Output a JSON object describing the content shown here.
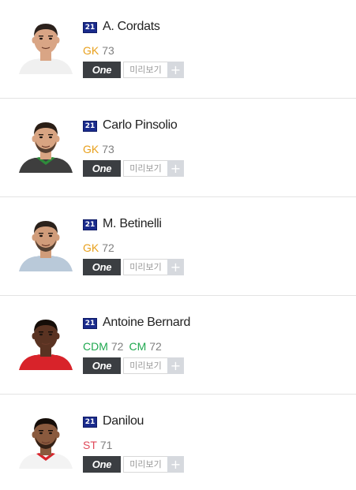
{
  "player_list": {
    "players": [
      {
        "season": "21",
        "name": "A. Cordats",
        "positions": [
          {
            "code": "GK",
            "ovr": "73",
            "color": "#e8a01d"
          }
        ],
        "one_label": "One",
        "preview_label": "미리보기",
        "add_label": "+",
        "kit_color": "#f0f0f0",
        "collar_color": "#f0f0f0",
        "skin_color": "#d9a585",
        "hair_color": "#2b211c",
        "beard": false
      },
      {
        "season": "21",
        "name": "Carlo Pinsolio",
        "positions": [
          {
            "code": "GK",
            "ovr": "73",
            "color": "#e8a01d"
          }
        ],
        "one_label": "One",
        "preview_label": "미리보기",
        "add_label": "+",
        "kit_color": "#3e3e3e",
        "collar_color": "#2e8b3a",
        "skin_color": "#d8a482",
        "hair_color": "#2a1e16",
        "beard": true
      },
      {
        "season": "21",
        "name": "M. Betinelli",
        "positions": [
          {
            "code": "GK",
            "ovr": "72",
            "color": "#e8a01d"
          }
        ],
        "one_label": "One",
        "preview_label": "미리보기",
        "add_label": "+",
        "kit_color": "#b9c9d9",
        "collar_color": "#b9c9d9",
        "skin_color": "#d09c7a",
        "hair_color": "#2a211b",
        "beard": true
      },
      {
        "season": "21",
        "name": "Antoine Bernard",
        "positions": [
          {
            "code": "CDM",
            "ovr": "72",
            "color": "#1fa84f"
          },
          {
            "code": "CM",
            "ovr": "72",
            "color": "#1fa84f"
          }
        ],
        "one_label": "One",
        "preview_label": "미리보기",
        "add_label": "+",
        "kit_color": "#d8232a",
        "collar_color": "#d8232a",
        "skin_color": "#5a3322",
        "hair_color": "#150d08",
        "beard": false
      },
      {
        "season": "21",
        "name": "Danilou",
        "positions": [
          {
            "code": "ST",
            "ovr": "71",
            "color": "#e04a5a"
          }
        ],
        "one_label": "One",
        "preview_label": "미리보기",
        "add_label": "+",
        "kit_color": "#f3f3f3",
        "collar_color": "#d8232a",
        "skin_color": "#8a5a3e",
        "hair_color": "#150d08",
        "beard": true
      }
    ]
  }
}
